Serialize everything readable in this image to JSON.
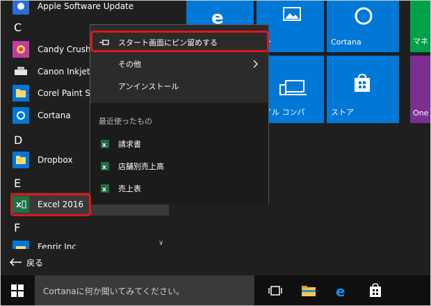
{
  "applist": {
    "top_item": "Apple Software Update",
    "letter_c": "C",
    "candy": "Candy Crush S",
    "canon": "Canon Inkjet P",
    "corel": "Corel Paint Sho",
    "cortana": "Cortana",
    "letter_d": "D",
    "dropbox": "Dropbox",
    "letter_e": "E",
    "excel": "Excel 2016",
    "letter_f": "F",
    "partial": "Fenrir Inc",
    "back": "戻る"
  },
  "tiles": {
    "photo": "ォト",
    "cortana": "Cortana",
    "money": "マネ",
    "phone": "バイル コンパ",
    "store": "ストア",
    "onenote": "One"
  },
  "context_menu": {
    "pin": "スタート画面にピン留めする",
    "more": "その他",
    "uninstall": "アンインストール",
    "recent_header": "最近使ったもの",
    "recent": [
      "請求書",
      "店舗別売上高",
      "売上表"
    ]
  },
  "taskbar": {
    "search_placeholder": "Cortanaに何か聞いてみてください。"
  }
}
